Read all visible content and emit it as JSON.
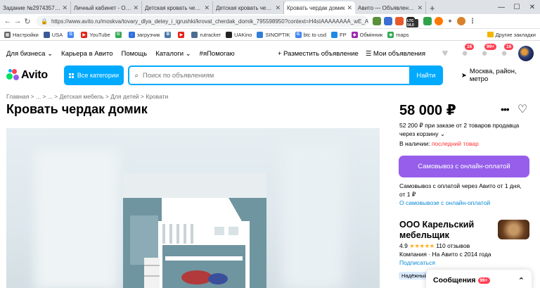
{
  "browser": {
    "tabs": [
      {
        "title": "Задание №2974357 - ...",
        "favicon_text": "SP",
        "favicon_color": "#b02a2a"
      },
      {
        "title": "Личный кабинет - Обь...",
        "favicon_text": "",
        "favicon_color": "#4b72c8"
      },
      {
        "title": "Детская кровать чердак...",
        "favicon_text": "",
        "favicon_color": "#e03c3c"
      },
      {
        "title": "Детская кровать чердак...",
        "favicon_text": "",
        "favicon_color": "#e03c3c"
      },
      {
        "title": "Кровать чердак домик",
        "favicon_text": "",
        "favicon_color": "#2f9e4e",
        "active": true
      },
      {
        "title": "Авито — Объявления с...",
        "favicon_text": "",
        "favicon_color": "#2f9e4e"
      }
    ],
    "new_tab": "+",
    "window_controls": {
      "minimize": "—",
      "maximize": "☐",
      "close": "✕"
    },
    "url": "https://www.avito.ru/moskva/tovary_dlya_detey_i_igrushki/krovat_cherdak_domik_795598950?context=H4sIAAAAAAAA_wE_AM...",
    "extensions": [
      {
        "icon": "extension-icon",
        "color": "#5a8f3b",
        "badge": ""
      },
      {
        "icon": "extension-icon",
        "color": "#3d6fd1",
        "badge": ""
      },
      {
        "icon": "extension-icon",
        "color": "#e85a2a",
        "badge": ""
      },
      {
        "icon": "extension-icon",
        "color": "#222222",
        "badge": "LTC 54.0"
      },
      {
        "icon": "extension-icon",
        "color": "#31a24c",
        "badge": ""
      },
      {
        "icon": "extension-icon",
        "color": "#ff7700",
        "badge": ""
      }
    ],
    "bookmarks": [
      {
        "label": "Настройки",
        "color": "#666666"
      },
      {
        "label": "USA",
        "color": "#3b5998"
      },
      {
        "label": "",
        "color": "#4285f4"
      },
      {
        "label": "YouTube",
        "color": "#e62117"
      },
      {
        "label": "",
        "color": "#34a853"
      },
      {
        "label": "загрузчик",
        "color": "#2f6fe0"
      },
      {
        "label": "",
        "color": "#4a76a8"
      },
      {
        "label": "",
        "color": "#e62117"
      },
      {
        "label": "rutracker",
        "color": "#4b6e8f"
      },
      {
        "label": "UAKino",
        "color": "#222222"
      },
      {
        "label": "SINOPTIK",
        "color": "#2f7ed8"
      },
      {
        "label": "btc to usd",
        "color": "#4285f4"
      },
      {
        "label": "FP",
        "color": "#1e88e5"
      },
      {
        "label": "Обмінник",
        "color": "#9c27b0"
      },
      {
        "label": "maps",
        "color": "#34a853"
      }
    ],
    "bookmarks_other": "Другие закладки"
  },
  "header": {
    "nav": [
      "Для бизнеса",
      "Карьера в Авито",
      "Помощь",
      "Каталоги",
      "#яПомогаю"
    ],
    "post_ad": "Разместить объявление",
    "my_ads": "Мои объявления",
    "badges": {
      "messages": "16",
      "notifications": "99+",
      "cart": "16"
    }
  },
  "search": {
    "logo": "Avito",
    "categories_button": "Все категории",
    "placeholder": "Поиск по объявлениям",
    "find_button": "Найти",
    "location": "Москва, район, метро"
  },
  "breadcrumb": "Главная  >  ...  >  ...  >  Детская мебель  >  Для детей  >  Кровати",
  "listing": {
    "title": "Кровать чердак домик",
    "price": "58 000 ₽",
    "installment_line1": "52 200 ₽ при заказе от 2 товаров продавца",
    "installment_line2": "через корзину",
    "stock_label": "В наличии:",
    "stock_value": "последний товар",
    "pickup_button": "Самовывоз с онлайн-оплатой",
    "pickup_info_line1": "Самовывоз с оплатой через Авито от 1 дня,",
    "pickup_info_line2": "от 1 ₽",
    "pickup_link": "О самовывозе с онлайн-оплатой"
  },
  "seller": {
    "name": "ООО Карельский мебельщик",
    "rating": "4.9",
    "stars": "★★★★★",
    "reviews": "110 отзывов",
    "since": "Компания · На Авито с 2014 года",
    "subscribe": "Подписаться",
    "tag": "Надёжный"
  },
  "messages_panel": {
    "label": "Сообщения",
    "badge": "99+"
  },
  "colors": {
    "accent_blue": "#00aaff",
    "purple_button": "#965eeb",
    "badge_red": "#ff4053",
    "link_blue": "#0a8ad8"
  }
}
